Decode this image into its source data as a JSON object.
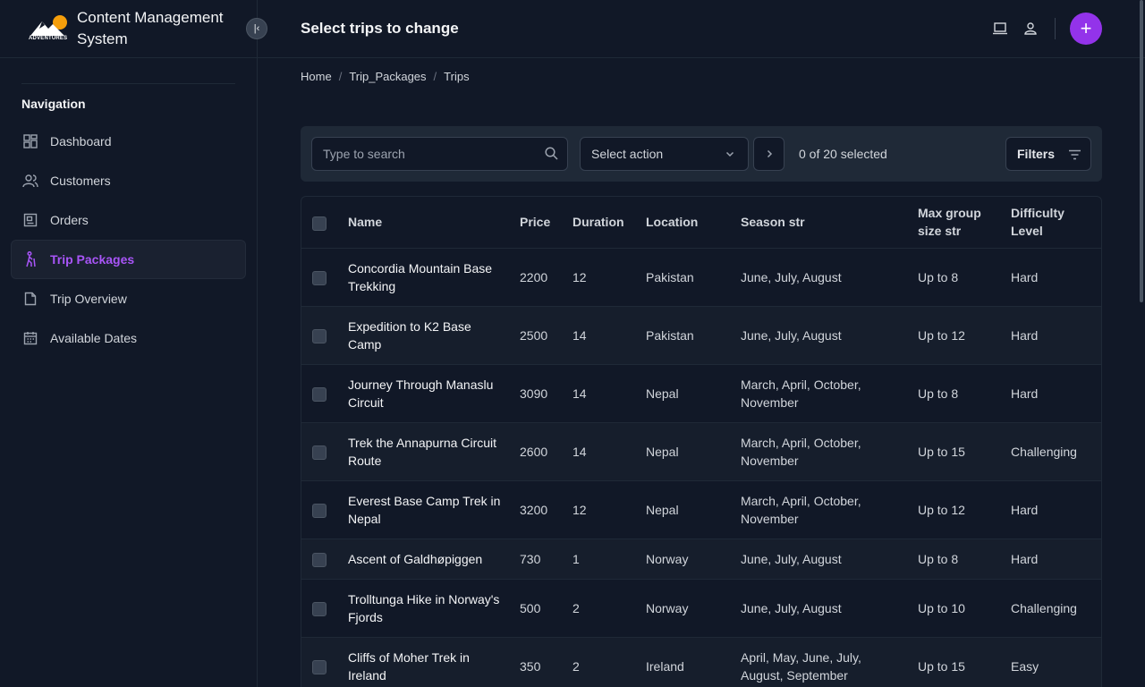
{
  "brand": {
    "title": "Content Management System",
    "logo_text": "ADVENTURES"
  },
  "sidebar": {
    "nav_title": "Navigation",
    "items": [
      {
        "label": "Dashboard",
        "icon": "dashboard-icon"
      },
      {
        "label": "Customers",
        "icon": "users-icon"
      },
      {
        "label": "Orders",
        "icon": "orders-icon"
      },
      {
        "label": "Trip Packages",
        "icon": "hiker-icon",
        "active": true
      },
      {
        "label": "Trip Overview",
        "icon": "document-icon"
      },
      {
        "label": "Available Dates",
        "icon": "calendar-icon"
      }
    ]
  },
  "header": {
    "title": "Select trips to change",
    "add_label": "+"
  },
  "breadcrumb": {
    "home": "Home",
    "section": "Trip_Packages",
    "current": "Trips",
    "separator": "/"
  },
  "toolbar": {
    "search_placeholder": "Type to search",
    "action_select": "Select action",
    "selected_count": "0 of 20 selected",
    "filters_label": "Filters"
  },
  "table": {
    "columns": [
      "Name",
      "Price",
      "Duration",
      "Location",
      "Season str",
      "Max group size str",
      "Difficulty Level"
    ],
    "rows": [
      [
        "Concordia Mountain Base Trekking",
        "2200",
        "12",
        "Pakistan",
        "June, July, August",
        "Up to 8",
        "Hard"
      ],
      [
        "Expedition to K2 Base Camp",
        "2500",
        "14",
        "Pakistan",
        "June, July, August",
        "Up to 12",
        "Hard"
      ],
      [
        "Journey Through Manaslu Circuit",
        "3090",
        "14",
        "Nepal",
        "March, April, October, November",
        "Up to 8",
        "Hard"
      ],
      [
        "Trek the Annapurna Circuit Route",
        "2600",
        "14",
        "Nepal",
        "March, April, October, November",
        "Up to 15",
        "Challenging"
      ],
      [
        "Everest Base Camp Trek in Nepal",
        "3200",
        "12",
        "Nepal",
        "March, April, October, November",
        "Up to 12",
        "Hard"
      ],
      [
        "Ascent of Galdhøpiggen",
        "730",
        "1",
        "Norway",
        "June, July, August",
        "Up to 8",
        "Hard"
      ],
      [
        "Trolltunga Hike in Norway's Fjords",
        "500",
        "2",
        "Norway",
        "June, July, August",
        "Up to 10",
        "Challenging"
      ],
      [
        "Cliffs of Moher Trek in Ireland",
        "350",
        "2",
        "Ireland",
        "April, May, June, July, August, September",
        "Up to 15",
        "Easy"
      ]
    ]
  },
  "colors": {
    "accent": "#9333ea",
    "active_nav": "#a855f7",
    "background": "#111827",
    "sun": "#f59e0b"
  }
}
